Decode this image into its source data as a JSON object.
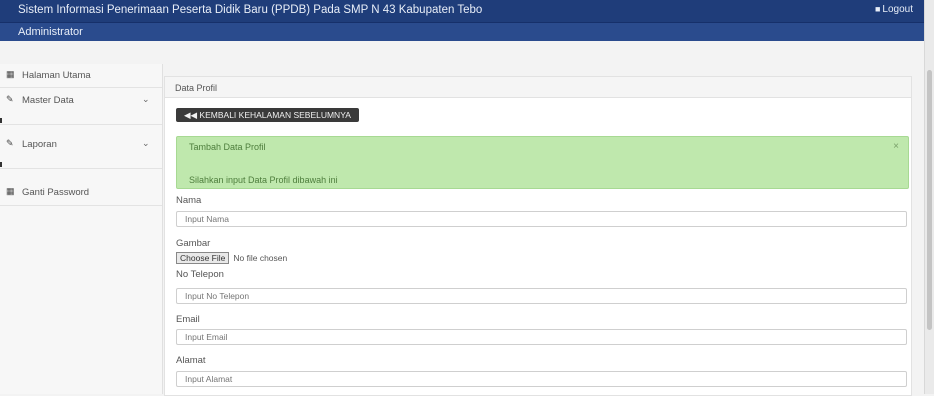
{
  "header": {
    "title": "Sistem Informasi Penerimaan Peserta Didik Baru (PPDB) Pada SMP N 43 Kabupaten Tebo",
    "logout_label": "Logout",
    "logout_icon": "user-icon",
    "role_label": "Administrator",
    "brand_color": "#1f3d7a"
  },
  "sidebar": {
    "items": [
      {
        "label": "Halaman Utama",
        "icon": "calendar-icon"
      },
      {
        "label": "Master Data",
        "icon": "edit-icon"
      },
      {
        "label": "Laporan",
        "icon": "edit-icon"
      },
      {
        "label": "Ganti Password",
        "icon": "calendar-icon"
      }
    ]
  },
  "panel": {
    "heading": "Data Profil",
    "back_button": "◀◀ KEMBALI KEHALAMAN SEBELUMNYA",
    "alert": {
      "title": "Tambah Data Profil",
      "message": "Silahkan input Data Profil dibawah ini",
      "close": "×",
      "color": "#bfe8ad"
    },
    "form": {
      "nama_label": "Nama",
      "nama_placeholder": "Input Nama",
      "gambar_label": "Gambar",
      "file_button": "Choose File",
      "file_status": "No file chosen",
      "telepon_label": "No Telepon",
      "telepon_placeholder": "Input No Telepon",
      "email_label": "Email",
      "email_placeholder": "Input Email",
      "alamat_label": "Alamat",
      "alamat_placeholder": "Input Alamat"
    }
  }
}
